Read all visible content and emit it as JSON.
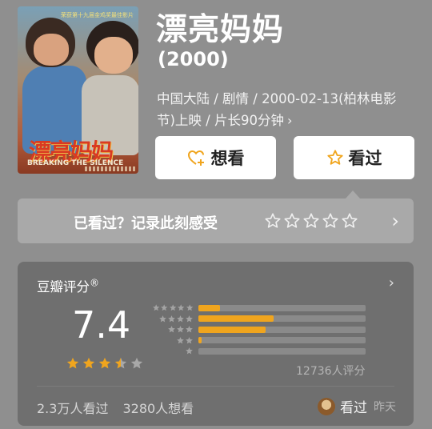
{
  "poster": {
    "top_text": "荣获第十九届金鸡奖最佳影片",
    "title_art": "漂亮妈妈",
    "subtitle": "BREAKING THE SILENCE"
  },
  "movie": {
    "title": "漂亮妈妈",
    "year": "(2000)",
    "meta": "中国大陆 / 剧情 / 2000-02-13(柏林电影节)上映 / 片长90分钟",
    "meta_chevron": "›"
  },
  "actions": {
    "want_label": "想看",
    "seen_label": "看过"
  },
  "record": {
    "prompt": "已看过？记录此刻感受",
    "star_count": 5,
    "chevron": "›"
  },
  "rating": {
    "label": "豆瓣评分",
    "registered_mark": "®",
    "chevron": "›",
    "score": "7.4",
    "stars_filled": 3.5,
    "distribution": [
      {
        "stars": 5,
        "fraction": 0.13
      },
      {
        "stars": 4,
        "fraction": 0.45
      },
      {
        "stars": 3,
        "fraction": 0.4
      },
      {
        "stars": 2,
        "fraction": 0.02
      },
      {
        "stars": 1,
        "fraction": 0.0
      }
    ],
    "count_text": "12736人评分",
    "seen_count": "2.3万人看过",
    "want_count": "3280人想看",
    "user_status": "看过",
    "user_when": "昨天"
  },
  "colors": {
    "accent": "#f0a51e",
    "background": "#8f8f8f",
    "card": "#6f6f6f"
  }
}
